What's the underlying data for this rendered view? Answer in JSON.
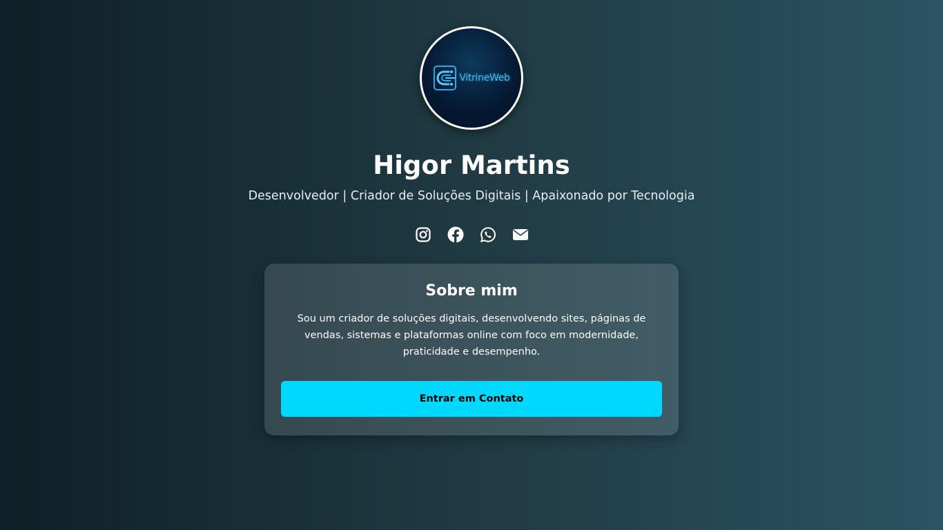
{
  "profile": {
    "avatar_logo_text": "VitrineWeb",
    "name": "Higor Martins",
    "tagline": "Desenvolvedor | Criador de Soluções Digitais | Apaixonado por Tecnologia"
  },
  "socials": [
    {
      "icon": "instagram-icon"
    },
    {
      "icon": "facebook-icon"
    },
    {
      "icon": "whatsapp-icon"
    },
    {
      "icon": "email-icon"
    }
  ],
  "about": {
    "title": "Sobre mim",
    "text": "Sou um criador de soluções digitais, desenvolvendo sites, páginas de vendas, sistemas e plataformas online com foco em modernidade, praticidade e desempenho.",
    "cta_label": "Entrar em Contato"
  },
  "colors": {
    "background_start": "#0f2027",
    "background_end": "#2c5364",
    "accent": "#00d8ff",
    "logo": "#45b8ee"
  }
}
